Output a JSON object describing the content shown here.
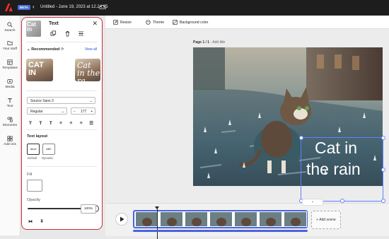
{
  "topbar": {
    "beta_badge": "BETA",
    "document_title": "Untitled - June 19, 2023 at 12.24.05"
  },
  "leftrail": {
    "items": [
      {
        "label": "Search",
        "icon": "search-icon"
      },
      {
        "label": "Your stuff",
        "icon": "folder-icon"
      },
      {
        "label": "Templates",
        "icon": "templates-icon"
      },
      {
        "label": "Media",
        "icon": "media-icon"
      },
      {
        "label": "Text",
        "icon": "text-icon"
      },
      {
        "label": "Elements",
        "icon": "elements-icon"
      },
      {
        "label": "Add-ons",
        "icon": "addons-icon"
      }
    ]
  },
  "text_panel": {
    "title": "Text",
    "thumb_text": "Cat in",
    "recommended_label": "Recommended",
    "view_all": "View all",
    "recommended_fonts": [
      {
        "preview": "CAT IN"
      },
      {
        "preview": "Cat in the ra"
      }
    ],
    "font_family": "Source Sans 3",
    "font_weight": "Regular",
    "font_size": "177",
    "format_buttons": [
      "T",
      "T",
      "T",
      "≡",
      "≡",
      "≡",
      "☰"
    ],
    "text_layout_label": "Text layout",
    "layouts": [
      {
        "label": "Default",
        "preview": "Abcd"
      },
      {
        "label": "Dynamic",
        "preview": "ABC"
      }
    ],
    "fill_label": "Fill",
    "fill_color": "#ffffff",
    "opacity_label": "Opacity",
    "opacity_value": "100%",
    "opacity_fraction": 1.0
  },
  "canvas_toolbar": {
    "resize": "Resize",
    "theme": "Theme",
    "background_color": "Background color"
  },
  "page": {
    "label_bold": "Page 1 / 1",
    "label_rest": " - Add title"
  },
  "artboard": {
    "text_line1": "Cat in",
    "text_line2": "the rain"
  },
  "timeline": {
    "add_scene": "+ Add scene",
    "frame_count": 7
  },
  "colors": {
    "accent": "#4863e2",
    "panel_border": "#cc2b3a",
    "topbar": "#1d1d1d"
  }
}
